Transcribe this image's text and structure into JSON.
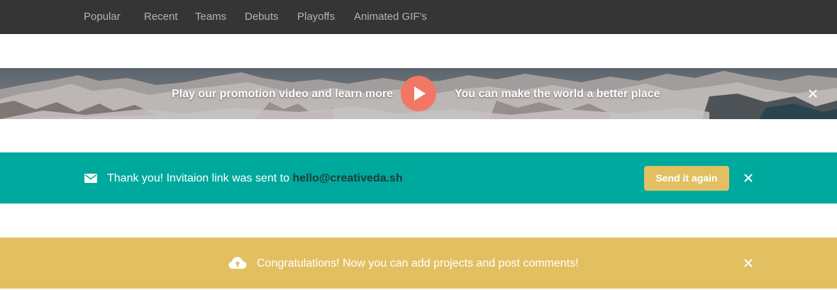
{
  "nav": {
    "items": [
      "Popular",
      "Recent",
      "Teams",
      "Debuts",
      "Playoffs",
      "Animated GIF's"
    ]
  },
  "promo": {
    "left_text": "Play our promotion video and learn more",
    "right_text": "You can make the world a better place",
    "play_icon": "play-icon",
    "close_icon": "close-icon"
  },
  "invite": {
    "message": "Thank you! Invitaion link was sent to",
    "email": "hello@creativeda.sh",
    "button_label": "Send it again",
    "icon": "mail-icon",
    "close_icon": "close-icon"
  },
  "congrats": {
    "message": "Congratulations! Now you can add projects and post comments!",
    "icon": "cloud-upload-icon",
    "close_icon": "close-icon"
  },
  "colors": {
    "nav_bg": "#353535",
    "nav_text": "#b3b3b3",
    "play_button": "#f27764",
    "teal": "#00a99d",
    "yellow": "#e2c062",
    "email_text": "#1f3b3a"
  }
}
